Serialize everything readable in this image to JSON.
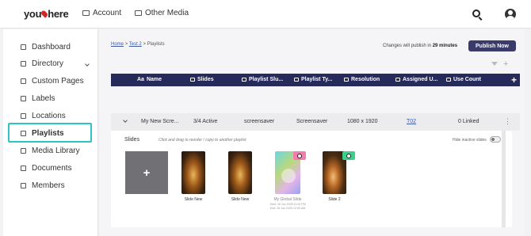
{
  "topbar": {
    "logo_text_a": "you",
    "logo_text_b": "here",
    "nav_account": "Account",
    "nav_media": "Other Media"
  },
  "sidebar": {
    "items": [
      {
        "label": "Dashboard",
        "icon": "dashboard-icon"
      },
      {
        "label": "Directory",
        "icon": "directory-icon",
        "has_caret": true
      },
      {
        "label": "Custom Pages",
        "icon": "page-icon"
      },
      {
        "label": "Labels",
        "icon": "label-icon"
      },
      {
        "label": "Locations",
        "icon": "location-pin-icon"
      },
      {
        "label": "Playlists",
        "icon": "playlist-icon",
        "active": true
      },
      {
        "label": "Media Library",
        "icon": "media-icon"
      },
      {
        "label": "Documents",
        "icon": "document-icon"
      },
      {
        "label": "Members",
        "icon": "members-icon"
      }
    ],
    "highlight_color": "#2ec4c0"
  },
  "breadcrumb": {
    "home": "Home",
    "sep1": ">",
    "project": "Test 2",
    "sep2": ">",
    "current": "Playlists"
  },
  "publish": {
    "note_prefix": "Changes will publish in",
    "note_time": "29 minutes",
    "button": "Publish Now",
    "button_color": "#3a3a6b"
  },
  "table": {
    "header_color": "#252a5a",
    "columns": [
      {
        "label": "Name",
        "prefix": "Aa"
      },
      {
        "label": "Slides"
      },
      {
        "label": "Playlist Slu..."
      },
      {
        "label": "Playlist Ty..."
      },
      {
        "label": "Resolution"
      },
      {
        "label": "Assigned U..."
      },
      {
        "label": "Use Count"
      }
    ],
    "rows": [
      {
        "name": "My New Scre...",
        "slides": "3/4 Active",
        "slug": "screensaver",
        "type": "Screensaver",
        "resolution": "1080 x 1920",
        "assigned": "T02",
        "use_count": "0 Linked"
      }
    ]
  },
  "slides": {
    "title": "Slides",
    "hint": "Click and drag to reorder / copy to another playlist",
    "hide_inactive_label": "Hide inactive slides",
    "items": [
      {
        "caption": "Slide New",
        "kind": "food"
      },
      {
        "caption": "Slide New",
        "kind": "food"
      },
      {
        "caption": "My Global Slide",
        "kind": "global",
        "muted": true,
        "meta1": "Start: 26 Jun 2025 11:00 PM",
        "meta2": "End: 26 Jun 2025 12:00 AM"
      },
      {
        "caption": "Slide 2",
        "kind": "table"
      }
    ]
  }
}
